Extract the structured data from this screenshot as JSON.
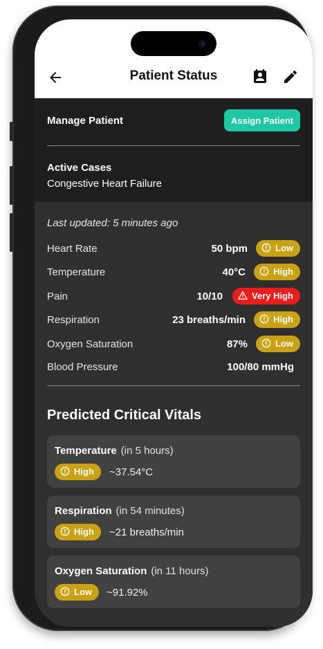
{
  "header": {
    "title": "Patient Status",
    "back_icon": "arrow-left-icon",
    "contact_icon": "contact-card-icon",
    "edit_icon": "pencil-icon"
  },
  "manage": {
    "label": "Manage Patient",
    "assign_label": "Assign Patient",
    "accent": "#1ec8a5",
    "active_cases_label": "Active Cases",
    "active_cases_value": "Congestive Heart Failure"
  },
  "vitals": {
    "last_updated": "Last updated: 5 minutes ago",
    "rows": [
      {
        "name": "Heart Rate",
        "value": "50 bpm",
        "badge": "Low",
        "level": "warn"
      },
      {
        "name": "Temperature",
        "value": "40°C",
        "badge": "High",
        "level": "warn"
      },
      {
        "name": "Pain",
        "value": "10/10",
        "badge": "Very High",
        "level": "danger"
      },
      {
        "name": "Respiration",
        "value": "23 breaths/min",
        "badge": "High",
        "level": "warn"
      },
      {
        "name": "Oxygen Saturation",
        "value": "87%",
        "badge": "Low",
        "level": "warn"
      },
      {
        "name": "Blood Pressure",
        "value": "100/80 mmHg",
        "badge": "",
        "level": ""
      }
    ],
    "colors": {
      "warn": "#caa214",
      "danger": "#ef1c1c"
    }
  },
  "predicted": {
    "title": "Predicted Critical Vitals",
    "cards": [
      {
        "name": "Temperature",
        "when": "(in 5 hours)",
        "badge": "High",
        "estimate": "~37.54°C"
      },
      {
        "name": "Respiration",
        "when": "(in 54 minutes)",
        "badge": "High",
        "estimate": "~21 breaths/min"
      },
      {
        "name": "Oxygen Saturation",
        "when": "(in 11 hours)",
        "badge": "Low",
        "estimate": "~91.92%"
      }
    ]
  }
}
